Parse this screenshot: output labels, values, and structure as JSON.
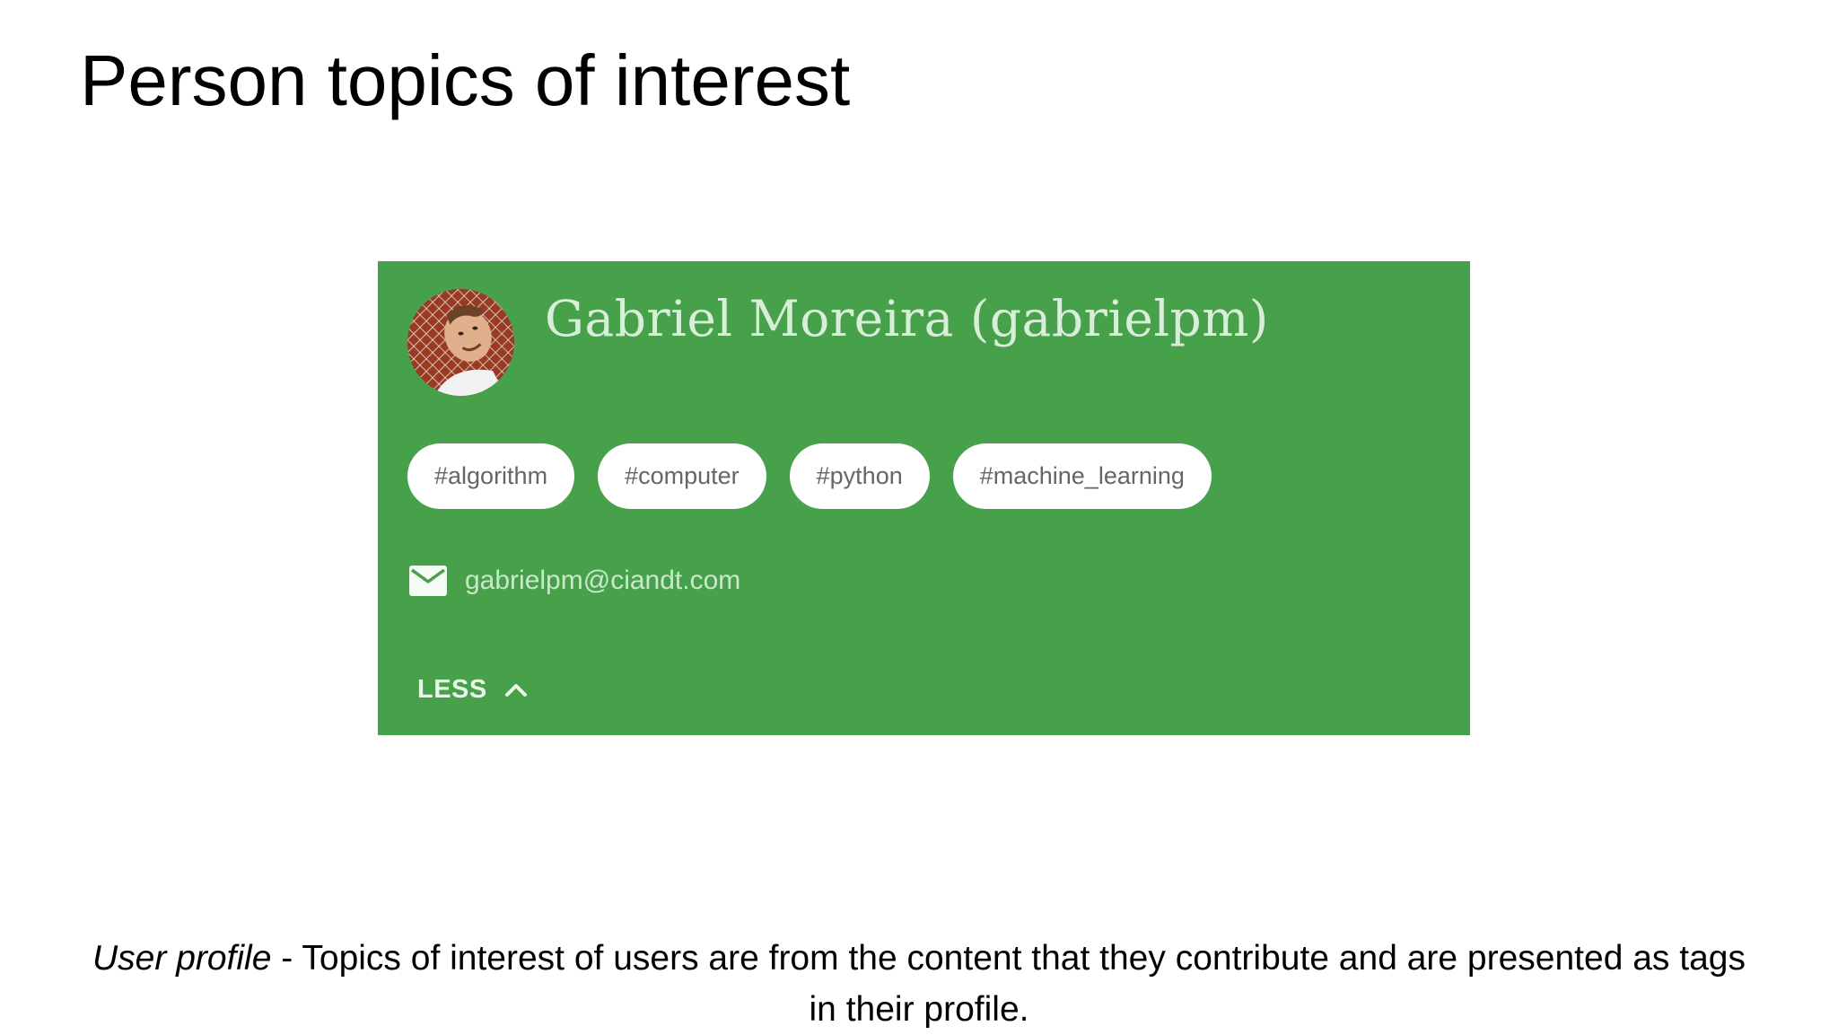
{
  "slide": {
    "title": "Person topics of interest"
  },
  "profile": {
    "name": "Gabriel Moreira (gabrielpm)",
    "avatar_icon": "user-photo-avatar",
    "card_color": "#47a14a",
    "tags": [
      "#algorithm",
      "#computer",
      "#python",
      "#machine_learning"
    ],
    "email_icon": "mail-icon",
    "email": "gabrielpm@ciandt.com",
    "toggle_label": "LESS",
    "toggle_icon": "chevron-up-icon"
  },
  "caption": {
    "emphasis": "User profile",
    "text": " - Topics of interest of users are from the content that they contribute and are presented as tags in their profile."
  }
}
